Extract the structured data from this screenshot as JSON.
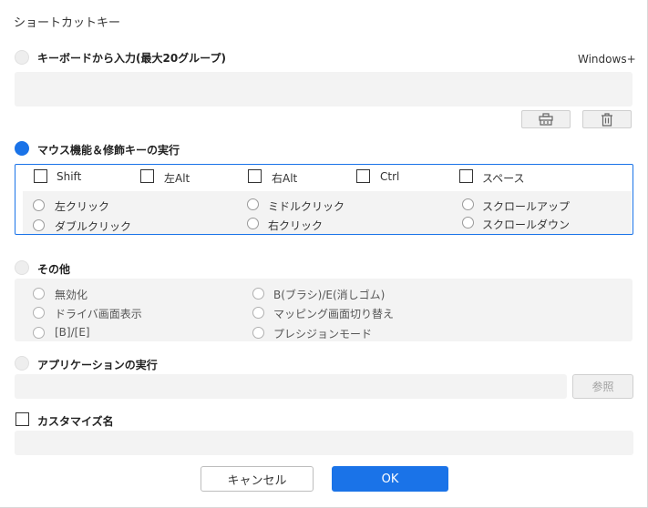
{
  "dialog": {
    "title": "ショートカットキー"
  },
  "keyboard": {
    "label": "キーボードから入力(最大20グループ)",
    "prefix": "Windows+",
    "selected": false
  },
  "mouse": {
    "label": "マウス機能＆修飾キーの実行",
    "selected": true,
    "modifiers": [
      {
        "label": "Shift",
        "checked": false
      },
      {
        "label": "左Alt",
        "checked": false
      },
      {
        "label": "右Alt",
        "checked": false
      },
      {
        "label": "Ctrl",
        "checked": false
      },
      {
        "label": "スペース",
        "checked": false
      }
    ],
    "actions": [
      {
        "label": "左クリック"
      },
      {
        "label": "ダブルクリック"
      },
      {
        "label": "ミドルクリック"
      },
      {
        "label": "右クリック"
      },
      {
        "label": "スクロールアップ"
      },
      {
        "label": "スクロールダウン"
      }
    ]
  },
  "other": {
    "label": "その他",
    "selected": false,
    "options": [
      {
        "label": "無効化"
      },
      {
        "label": "ドライバ画面表示"
      },
      {
        "label": "[B]/[E]"
      },
      {
        "label": "B(ブラシ)/E(消しゴム)"
      },
      {
        "label": "マッピング画面切り替え"
      },
      {
        "label": "プレシジョンモード"
      }
    ]
  },
  "app": {
    "label": "アプリケーションの実行",
    "selected": false,
    "path_value": "",
    "browse_label": "参照"
  },
  "custom": {
    "label": "カスタマイズ名",
    "checked": false,
    "value": ""
  },
  "footer": {
    "cancel_label": "キャンセル",
    "ok_label": "OK"
  },
  "icons": {
    "clear": "eraser-icon",
    "delete": "trash-icon"
  },
  "colors": {
    "accent": "#1a73e8",
    "panel_bg": "#f3f3f3"
  }
}
